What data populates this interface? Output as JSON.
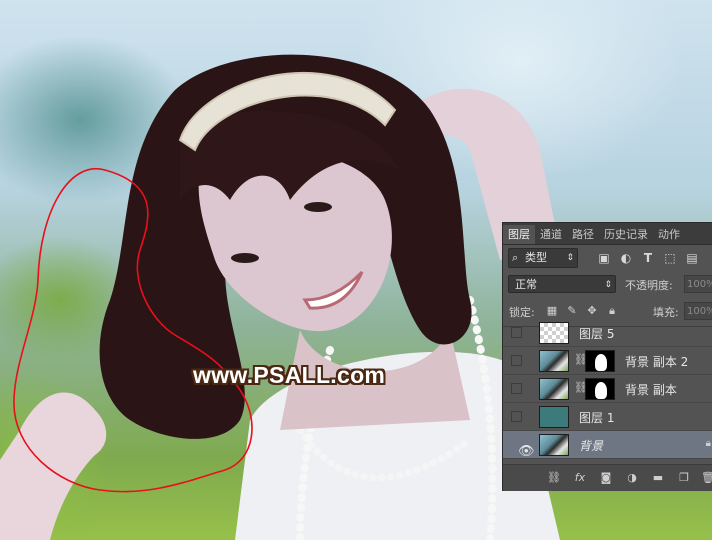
{
  "watermark": {
    "text": "www.PSALL.com"
  },
  "panel": {
    "tabs": [
      "图层",
      "通道",
      "路径",
      "历史记录",
      "动作"
    ],
    "active_tab": 0,
    "filter": {
      "label": "类型"
    },
    "blend_mode": "正常",
    "opacity_label": "不透明度:",
    "opacity_value": "100%",
    "lock_label": "锁定:",
    "fill_label": "填充:",
    "fill_value": "100%",
    "layers": [
      {
        "name": "图层 5",
        "visible": false,
        "thumb": "checker",
        "selected": false
      },
      {
        "name": "背景 副本 2",
        "visible": false,
        "thumb": "photo",
        "mask": true,
        "selected": false
      },
      {
        "name": "背景 副本",
        "visible": false,
        "thumb": "photo",
        "mask": true,
        "selected": false
      },
      {
        "name": "图层 1",
        "visible": false,
        "thumb": "teal",
        "selected": false
      },
      {
        "name": "背景",
        "visible": true,
        "thumb": "photo",
        "selected": true,
        "locked": true
      }
    ]
  },
  "colors": {
    "selection_path": "#e8101a",
    "panel_bg": "#535353",
    "selected_layer": "#6e7683"
  }
}
